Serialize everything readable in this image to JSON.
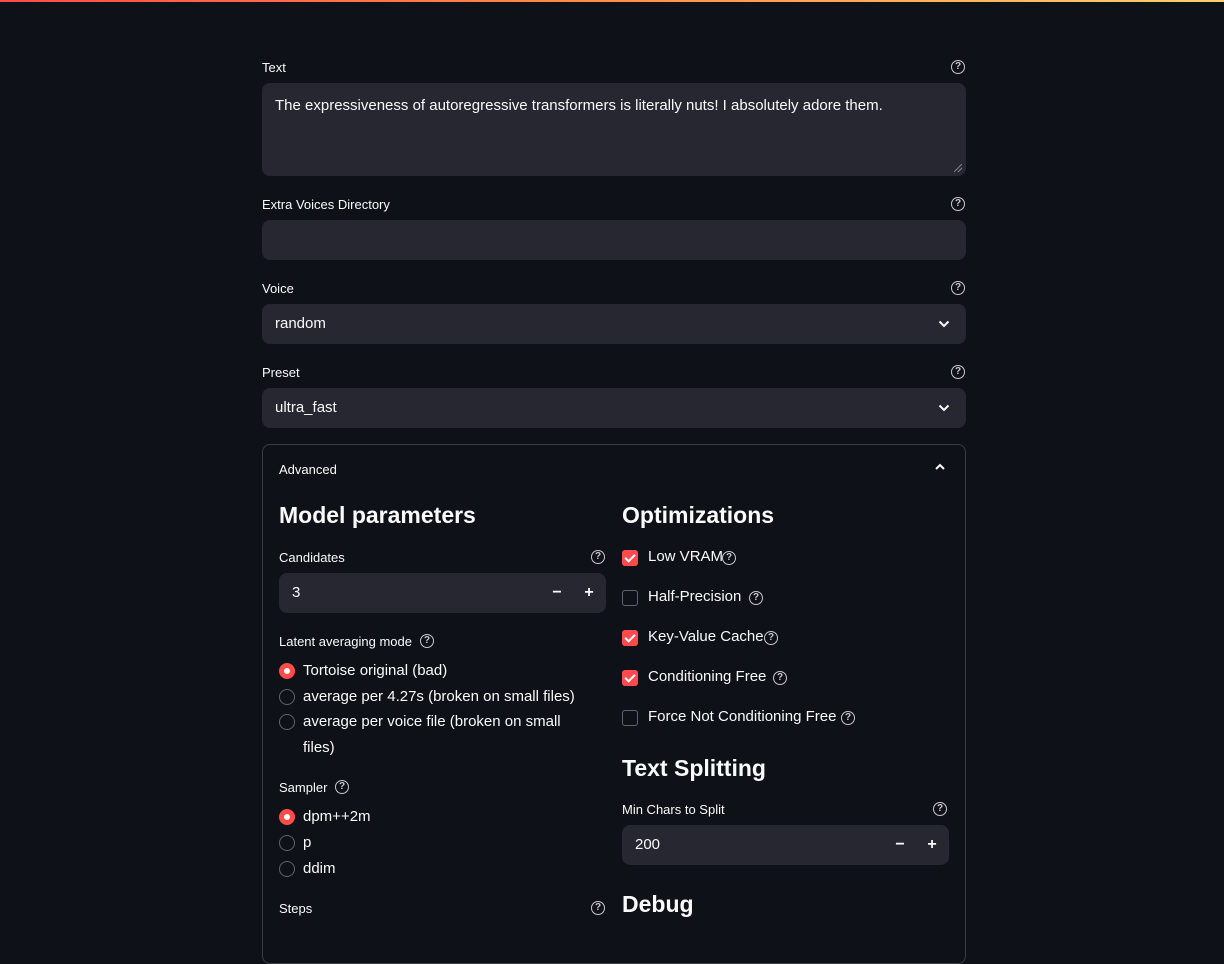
{
  "fields": {
    "text": {
      "label": "Text",
      "value": "The expressiveness of autoregressive transformers is literally nuts! I absolutely adore them."
    },
    "extra_voices": {
      "label": "Extra Voices Directory",
      "value": ""
    },
    "voice": {
      "label": "Voice",
      "value": "random"
    },
    "preset": {
      "label": "Preset",
      "value": "ultra_fast"
    }
  },
  "advanced": {
    "title": "Advanced",
    "model_parameters": {
      "heading": "Model parameters",
      "candidates": {
        "label": "Candidates",
        "value": "3"
      },
      "latent_mode": {
        "label": "Latent averaging mode",
        "options": [
          "Tortoise original (bad)",
          "average per 4.27s (broken on small files)",
          "average per voice file (broken on small",
          "files)"
        ],
        "selected": 0
      },
      "sampler": {
        "label": "Sampler",
        "options": [
          "dpm++2m",
          "p",
          "ddim"
        ],
        "selected": 0
      },
      "steps": {
        "label": "Steps"
      }
    },
    "optimizations": {
      "heading": "Optimizations",
      "items": [
        {
          "label": "Low VRAM",
          "checked": true
        },
        {
          "label": "Half-Precision",
          "checked": false
        },
        {
          "label": "Key-Value Cache",
          "checked": true
        },
        {
          "label": "Conditioning Free",
          "checked": true
        },
        {
          "label": "Force Not Conditioning Free",
          "checked": false
        }
      ]
    },
    "text_splitting": {
      "heading": "Text Splitting",
      "min_chars": {
        "label": "Min Chars to Split",
        "value": "200"
      }
    },
    "debug": {
      "heading": "Debug"
    }
  },
  "icons": {
    "help": "question-circle-icon",
    "chevron_down": "chevron-down-icon",
    "chevron_up": "chevron-up-icon",
    "minus": "minus-icon",
    "plus": "plus-icon"
  },
  "colors": {
    "accent": "#ff4b4b",
    "background": "#0e1117",
    "input_bg": "#262730"
  }
}
